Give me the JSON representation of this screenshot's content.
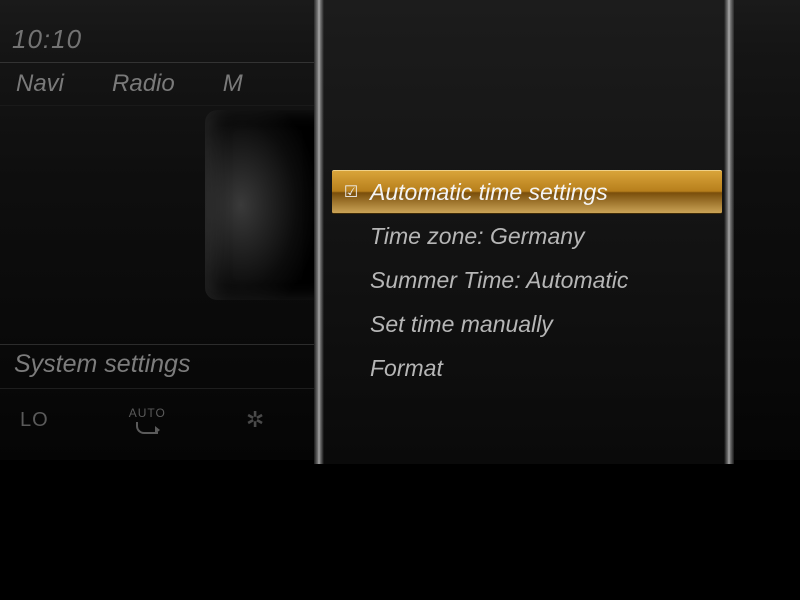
{
  "clock": "10:10",
  "topnav": {
    "items": [
      "Navi",
      "Radio",
      "M"
    ]
  },
  "section": {
    "label": "System settings"
  },
  "climate": {
    "lo": "LO",
    "auto": "AUTO"
  },
  "menu": {
    "items": [
      {
        "label": "Automatic time settings",
        "checked": true,
        "selected": true
      },
      {
        "label": "Time zone: Germany",
        "checked": false,
        "selected": false
      },
      {
        "label": "Summer Time: Automatic",
        "checked": false,
        "selected": false
      },
      {
        "label": "Set time manually",
        "checked": false,
        "selected": false
      },
      {
        "label": "Format",
        "checked": false,
        "selected": false
      }
    ]
  }
}
